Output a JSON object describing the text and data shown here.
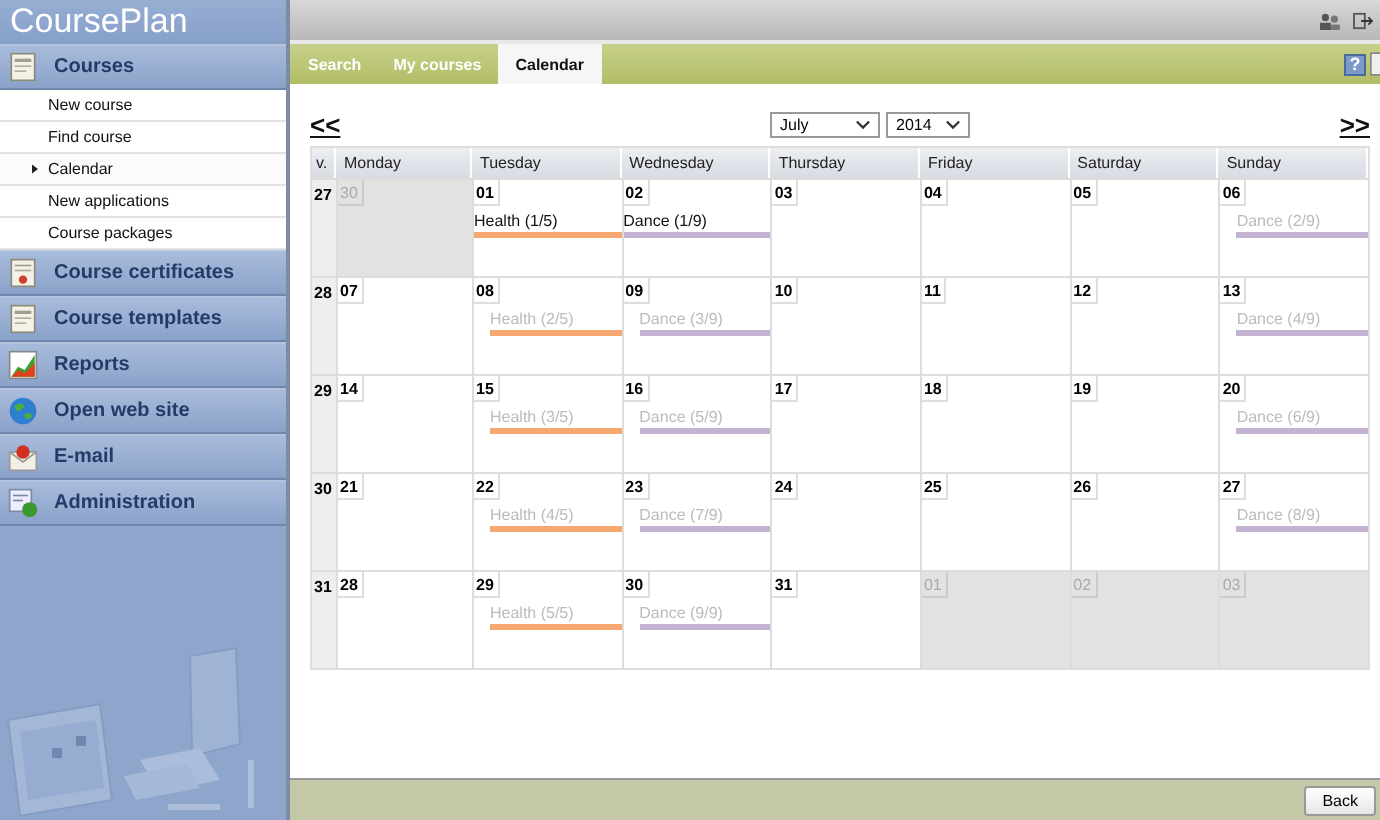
{
  "app": {
    "title": "CoursePlan"
  },
  "sidebar": {
    "sections": [
      {
        "label": "Courses",
        "items": [
          {
            "label": "New course",
            "selected": false
          },
          {
            "label": "Find course",
            "selected": false
          },
          {
            "label": "Calendar",
            "selected": true
          },
          {
            "label": "New applications",
            "selected": false
          },
          {
            "label": "Course packages",
            "selected": false
          }
        ]
      },
      {
        "label": "Course certificates"
      },
      {
        "label": "Course templates"
      },
      {
        "label": "Reports"
      },
      {
        "label": "Open web site"
      },
      {
        "label": "E-mail"
      },
      {
        "label": "Administration"
      }
    ]
  },
  "tabs": [
    {
      "label": "Search",
      "selected": false
    },
    {
      "label": "My courses",
      "selected": false
    },
    {
      "label": "Calendar",
      "selected": true
    }
  ],
  "help": "?",
  "calendar": {
    "prev": "<<",
    "next": ">>",
    "month": "July",
    "year": "2014",
    "columns": [
      "v.",
      "Monday",
      "Tuesday",
      "Wednesday",
      "Thursday",
      "Friday",
      "Saturday",
      "Sunday"
    ],
    "weeks": [
      {
        "number": "27",
        "days": [
          {
            "day": "30",
            "other_month": true
          },
          {
            "day": "01",
            "other_month": false,
            "events": [
              {
                "label": "Health (1/5)",
                "faded": false,
                "color": "#f5a86f"
              }
            ]
          },
          {
            "day": "02",
            "other_month": false,
            "events": [
              {
                "label": "Dance (1/9)",
                "faded": false,
                "color": "#c4b2d2"
              }
            ]
          },
          {
            "day": "03",
            "other_month": false
          },
          {
            "day": "04",
            "other_month": false
          },
          {
            "day": "05",
            "other_month": false
          },
          {
            "day": "06",
            "other_month": false,
            "events": [
              {
                "label": "Dance (2/9)",
                "faded": true,
                "color": "#c4b2d2"
              }
            ]
          }
        ]
      },
      {
        "number": "28",
        "days": [
          {
            "day": "07",
            "other_month": false
          },
          {
            "day": "08",
            "other_month": false,
            "events": [
              {
                "label": "Health (2/5)",
                "faded": true,
                "color": "#f5a86f"
              }
            ]
          },
          {
            "day": "09",
            "other_month": false,
            "events": [
              {
                "label": "Dance (3/9)",
                "faded": true,
                "color": "#c4b2d2"
              }
            ]
          },
          {
            "day": "10",
            "other_month": false
          },
          {
            "day": "11",
            "other_month": false
          },
          {
            "day": "12",
            "other_month": false
          },
          {
            "day": "13",
            "other_month": false,
            "events": [
              {
                "label": "Dance (4/9)",
                "faded": true,
                "color": "#c4b2d2"
              }
            ]
          }
        ]
      },
      {
        "number": "29",
        "days": [
          {
            "day": "14",
            "other_month": false
          },
          {
            "day": "15",
            "other_month": false,
            "events": [
              {
                "label": "Health (3/5)",
                "faded": true,
                "color": "#f5a86f"
              }
            ]
          },
          {
            "day": "16",
            "other_month": false,
            "events": [
              {
                "label": "Dance (5/9)",
                "faded": true,
                "color": "#c4b2d2"
              }
            ]
          },
          {
            "day": "17",
            "other_month": false
          },
          {
            "day": "18",
            "other_month": false
          },
          {
            "day": "19",
            "other_month": false
          },
          {
            "day": "20",
            "other_month": false,
            "events": [
              {
                "label": "Dance (6/9)",
                "faded": true,
                "color": "#c4b2d2"
              }
            ]
          }
        ]
      },
      {
        "number": "30",
        "days": [
          {
            "day": "21",
            "other_month": false
          },
          {
            "day": "22",
            "other_month": false,
            "events": [
              {
                "label": "Health (4/5)",
                "faded": true,
                "color": "#f5a86f"
              }
            ]
          },
          {
            "day": "23",
            "other_month": false,
            "events": [
              {
                "label": "Dance (7/9)",
                "faded": true,
                "color": "#c4b2d2"
              }
            ]
          },
          {
            "day": "24",
            "other_month": false
          },
          {
            "day": "25",
            "other_month": false
          },
          {
            "day": "26",
            "other_month": false
          },
          {
            "day": "27",
            "other_month": false,
            "events": [
              {
                "label": "Dance (8/9)",
                "faded": true,
                "color": "#c4b2d2"
              }
            ]
          }
        ]
      },
      {
        "number": "31",
        "days": [
          {
            "day": "28",
            "other_month": false
          },
          {
            "day": "29",
            "other_month": false,
            "events": [
              {
                "label": "Health (5/5)",
                "faded": true,
                "color": "#f5a86f"
              }
            ]
          },
          {
            "day": "30",
            "other_month": false,
            "events": [
              {
                "label": "Dance (9/9)",
                "faded": true,
                "color": "#c4b2d2"
              }
            ]
          },
          {
            "day": "31",
            "other_month": false
          },
          {
            "day": "01",
            "other_month": true
          },
          {
            "day": "02",
            "other_month": true
          },
          {
            "day": "03",
            "other_month": true
          }
        ]
      }
    ]
  },
  "footer": {
    "back": "Back"
  }
}
